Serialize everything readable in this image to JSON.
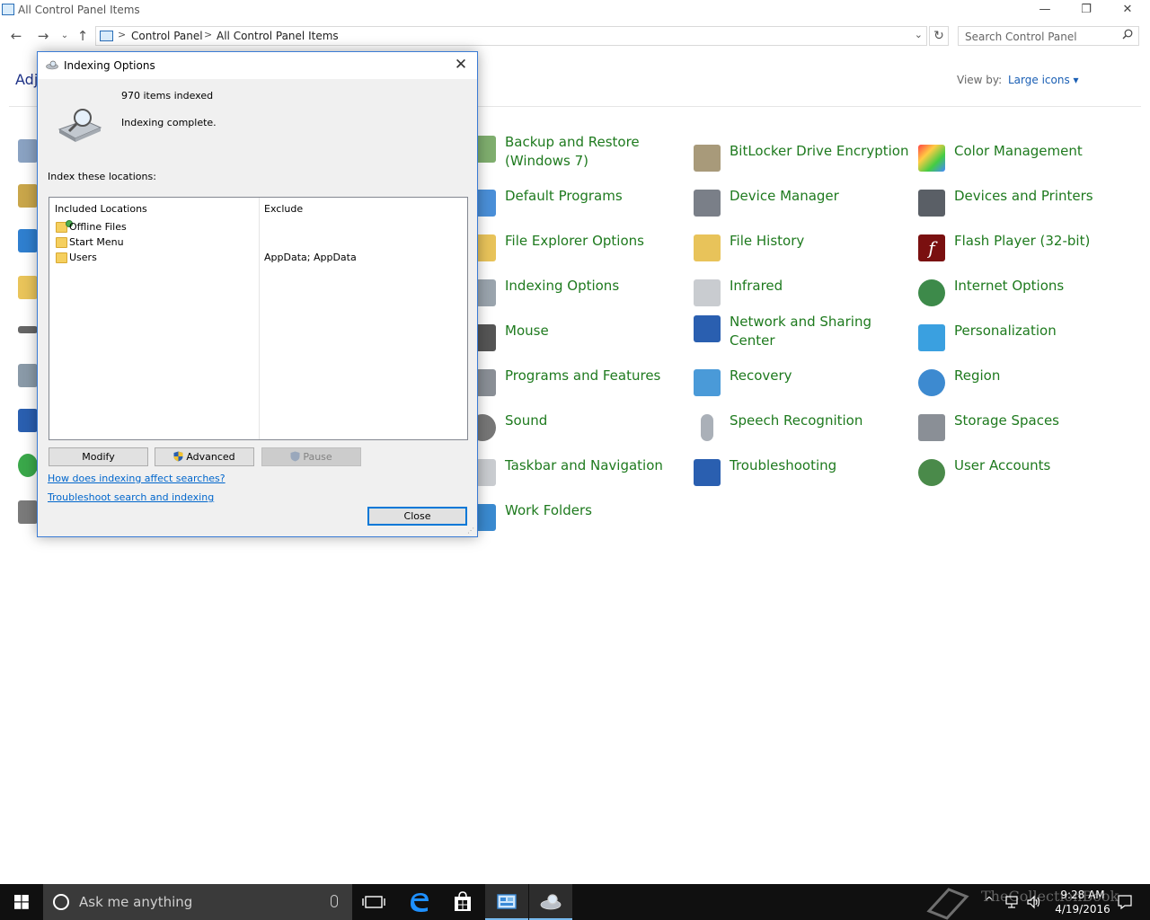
{
  "window": {
    "title": "All Control Panel Items",
    "minimize": "—",
    "restore": "❐",
    "close": "✕"
  },
  "address_bar": {
    "crumbs": [
      "Control Panel",
      "All Control Panel Items"
    ],
    "separator": ">",
    "search_placeholder": "Search Control Panel"
  },
  "header": {
    "heading_partial": "Adj",
    "view_by_label": "View by:",
    "view_by_value": "Large icons ▾"
  },
  "control_panel_items": [
    {
      "label": "Backup and Restore (Windows 7)",
      "icon": "backup-restore-icon"
    },
    {
      "label": "BitLocker Drive Encryption",
      "icon": "bitlocker-icon"
    },
    {
      "label": "Color Management",
      "icon": "color-management-icon"
    },
    {
      "label": "Default Programs",
      "icon": "default-programs-icon"
    },
    {
      "label": "Device Manager",
      "icon": "device-manager-icon"
    },
    {
      "label": "Devices and Printers",
      "icon": "devices-printers-icon"
    },
    {
      "label": "File Explorer Options",
      "icon": "file-explorer-options-icon"
    },
    {
      "label": "File History",
      "icon": "file-history-icon"
    },
    {
      "label": "Flash Player (32-bit)",
      "icon": "flash-player-icon"
    },
    {
      "label": "Indexing Options",
      "icon": "indexing-options-icon"
    },
    {
      "label": "Infrared",
      "icon": "infrared-icon"
    },
    {
      "label": "Internet Options",
      "icon": "internet-options-icon"
    },
    {
      "label": "Mouse",
      "icon": "mouse-icon"
    },
    {
      "label": "Network and Sharing Center",
      "icon": "network-sharing-icon"
    },
    {
      "label": "Personalization",
      "icon": "personalization-icon"
    },
    {
      "label": "Programs and Features",
      "icon": "programs-features-icon"
    },
    {
      "label": "Recovery",
      "icon": "recovery-icon"
    },
    {
      "label": "Region",
      "icon": "region-icon"
    },
    {
      "label": "Sound",
      "icon": "sound-icon"
    },
    {
      "label": "Speech Recognition",
      "icon": "speech-recognition-icon"
    },
    {
      "label": "Storage Spaces",
      "icon": "storage-spaces-icon"
    },
    {
      "label": "Taskbar and Navigation",
      "icon": "taskbar-navigation-icon"
    },
    {
      "label": "Troubleshooting",
      "icon": "troubleshooting-icon"
    },
    {
      "label": "User Accounts",
      "icon": "user-accounts-icon"
    },
    {
      "label": "Work Folders",
      "icon": "work-folders-icon"
    }
  ],
  "dialog": {
    "title": "Indexing Options",
    "close": "✕",
    "items_indexed": "970 items indexed",
    "status": "Indexing complete.",
    "index_label": "Index these locations:",
    "columns": {
      "included": "Included Locations",
      "exclude": "Exclude"
    },
    "locations": [
      {
        "name": "Offline Files",
        "exclude": ""
      },
      {
        "name": "Start Menu",
        "exclude": ""
      },
      {
        "name": "Users",
        "exclude": "AppData; AppData"
      }
    ],
    "buttons": {
      "modify": "Modify",
      "advanced": "Advanced",
      "pause": "Pause",
      "close": "Close"
    },
    "links": {
      "how": "How does indexing affect searches?",
      "troubleshoot": "Troubleshoot search and indexing"
    }
  },
  "taskbar": {
    "search_text": "Ask me anything",
    "time": "9:28 AM",
    "date": "4/19/2016",
    "watermark": "TheCollectionBook"
  },
  "colors": {
    "link_green": "#1e7a1e",
    "accent_blue": "#0078d7",
    "taskbar": "#101010"
  }
}
